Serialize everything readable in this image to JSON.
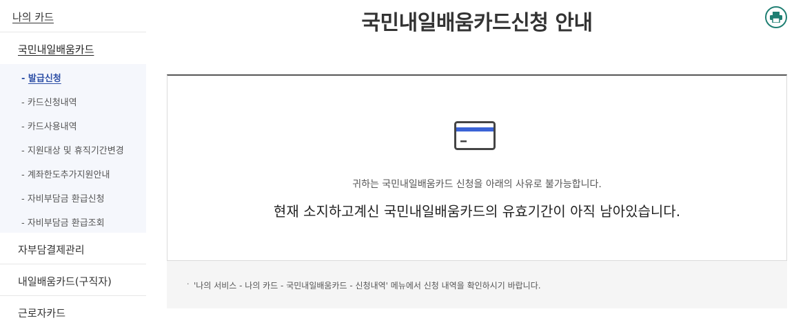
{
  "sidebar": {
    "top_label": "나의 카드",
    "section_label": "국민내일배움카드",
    "items": [
      {
        "prefix": "- ",
        "label": "발급신청"
      },
      {
        "prefix": "- ",
        "label": "카드신청내역"
      },
      {
        "prefix": "- ",
        "label": "카드사용내역"
      },
      {
        "prefix": "- ",
        "label": "지원대상 및 휴직기간변경"
      },
      {
        "prefix": "- ",
        "label": "계좌한도추가지원안내"
      },
      {
        "prefix": "- ",
        "label": "자비부담금 환급신청"
      },
      {
        "prefix": "- ",
        "label": "자비부담금 환급조회"
      }
    ],
    "menus": [
      {
        "label": "자부담결제관리"
      },
      {
        "label": "내일배움카드(구직자)"
      },
      {
        "label": "근로자카드"
      }
    ],
    "active_index": 0
  },
  "main": {
    "title": "국민내일배움카드신청 안내",
    "print_icon": "printer-icon",
    "card_icon": "credit-card-icon",
    "message_small": "귀하는 국민내일배움카드 신청을 아래의 사유로 불가능합니다.",
    "message_large": "현재 소지하고계신 국민내일배움카드의 유효기간이 아직 남아있습니다.",
    "note_bullet": "·",
    "note": "'나의 서비스 - 나의 카드 - 국민내일배움카드 - 신청내역' 메뉴에서 신청 내역을 확인하시기 바랍니다."
  },
  "colors": {
    "accent_blue": "#2d4fa6",
    "card_stripe": "#3b63d6",
    "print_teal": "#1f7f73",
    "title_border": "#555555",
    "sidebar_bg": "#f5f7fc",
    "note_bg": "#f5f5f5"
  }
}
